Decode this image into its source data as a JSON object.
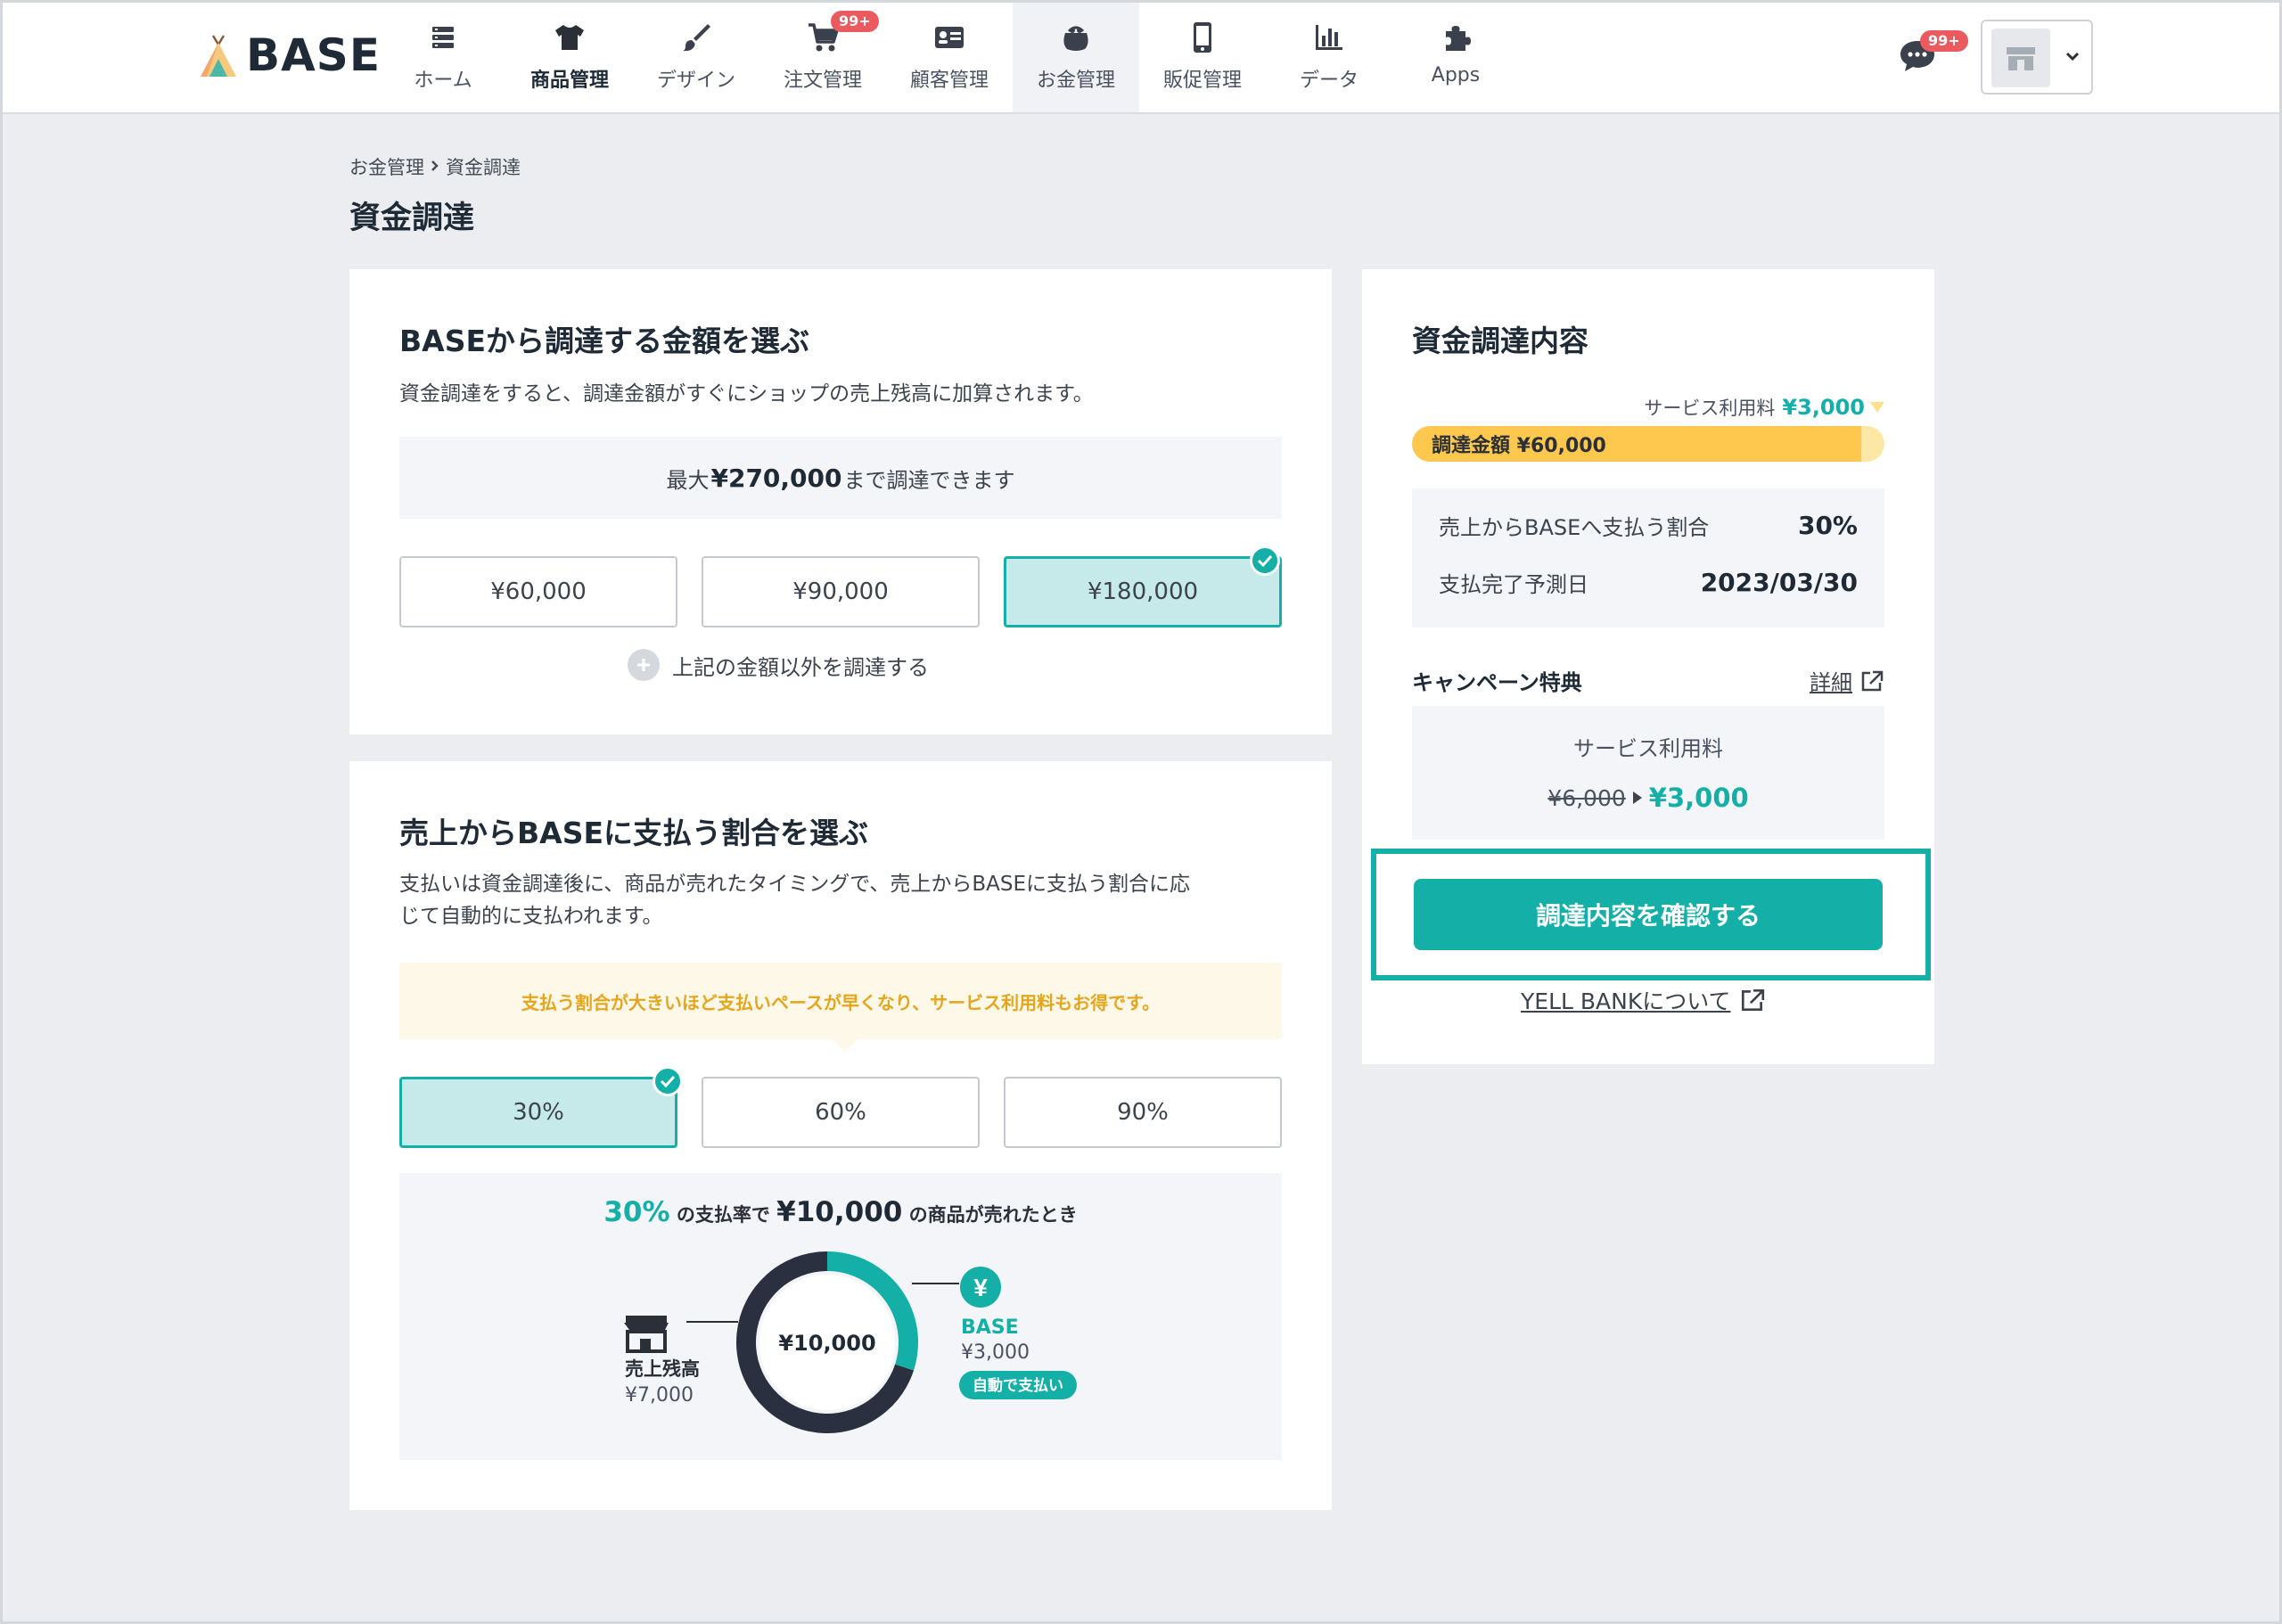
{
  "header": {
    "logo": "BASE",
    "nav": [
      {
        "label": "ホーム",
        "icon": "list-icon"
      },
      {
        "label": "商品管理",
        "icon": "tshirt-icon"
      },
      {
        "label": "デザイン",
        "icon": "brush-icon"
      },
      {
        "label": "注文管理",
        "icon": "cart-icon",
        "badge": "99+"
      },
      {
        "label": "顧客管理",
        "icon": "address-card-icon"
      },
      {
        "label": "お金管理",
        "icon": "wallet-icon"
      },
      {
        "label": "販促管理",
        "icon": "smartphone-icon"
      },
      {
        "label": "データ",
        "icon": "bar-chart-icon"
      },
      {
        "label": "Apps",
        "icon": "puzzle-icon"
      }
    ],
    "chat_badge": "99+"
  },
  "breadcrumb": {
    "parent": "お金管理",
    "current": "資金調達"
  },
  "page_title": "資金調達",
  "amount_card": {
    "title": "BASEから調達する金額を選ぶ",
    "desc": "資金調達をすると、調達金額がすぐにショップの売上残高に加算されます。",
    "max_prefix": "最大",
    "max_value": "¥270,000",
    "max_suffix": "まで調達できます",
    "options": [
      "¥60,000",
      "¥90,000",
      "¥180,000"
    ],
    "selected_index": 2,
    "other_link": "上記の金額以外を調達する"
  },
  "ratio_card": {
    "title": "売上からBASEに支払う割合を選ぶ",
    "desc_line1": "支払いは資金調達後に、商品が売れたタイミングで、売上からBASEに支払う割合に応",
    "desc_line2": "じて自動的に支払われます。",
    "notice": "支払う割合が大きいほど支払いペースが早くなり、サービス利用料もお得です。",
    "options": [
      "30%",
      "60%",
      "90%"
    ],
    "selected_index": 0,
    "sim": {
      "pct": "30%",
      "text1": "の支払率で",
      "amount": "¥10,000",
      "text2": "の商品が売れたとき",
      "center": "¥10,000",
      "left_label": "売上残高",
      "left_value": "¥7,000",
      "right_label": "BASE",
      "right_value": "¥3,000",
      "right_pill": "自動で支払い",
      "base_share": 0.3,
      "colors": {
        "base": "#14b0a8",
        "shop": "#2b3040"
      }
    }
  },
  "summary_card": {
    "title": "資金調達内容",
    "service_fee_label": "サービス利用料",
    "service_fee_value": "¥3,000",
    "progress_label": "調達金額 ¥60,000",
    "progress_fraction": 0.95,
    "rows": [
      {
        "label": "売上からBASEへ支払う割合",
        "value": "30%"
      },
      {
        "label": "支払完了予測日",
        "value": "2023/03/30"
      }
    ],
    "campaign_title": "キャンペーン特典",
    "campaign_detail": "詳細",
    "campaign_label": "サービス利用料",
    "campaign_old": "¥6,000",
    "campaign_new": "¥3,000",
    "cta": "調達内容を確認する",
    "yell_link": "YELL BANKについて"
  },
  "colors": {
    "accent": "#14b0a8",
    "notice_text": "#e5a51c",
    "progress": "#fdc84d",
    "badge": "#ea5a5f"
  }
}
